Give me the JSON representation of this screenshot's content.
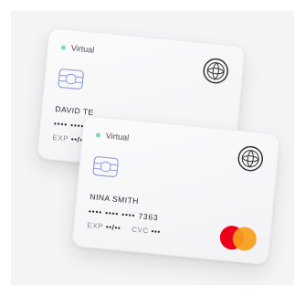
{
  "cards": {
    "back": {
      "type_label": "Virtual",
      "holder": "DAVID TE",
      "number_masked": "•••• ••••",
      "exp_label": "EXP",
      "exp_value": "••/•"
    },
    "front": {
      "type_label": "Virtual",
      "holder": "NINA SMITH",
      "number_masked": "•••• •••• •••• 7363",
      "exp_label": "EXP",
      "exp_value": "••/••",
      "cvc_label": "CVC",
      "cvc_value": "•••",
      "brand": "mastercard-logo"
    }
  },
  "colors": {
    "virtual_dot": "#79d6c8",
    "brand_red": "#eb001b",
    "brand_orange": "#f79e1b"
  },
  "icons": [
    "ornamental-emblem-icon",
    "chip-icon",
    "mastercard-logo"
  ]
}
